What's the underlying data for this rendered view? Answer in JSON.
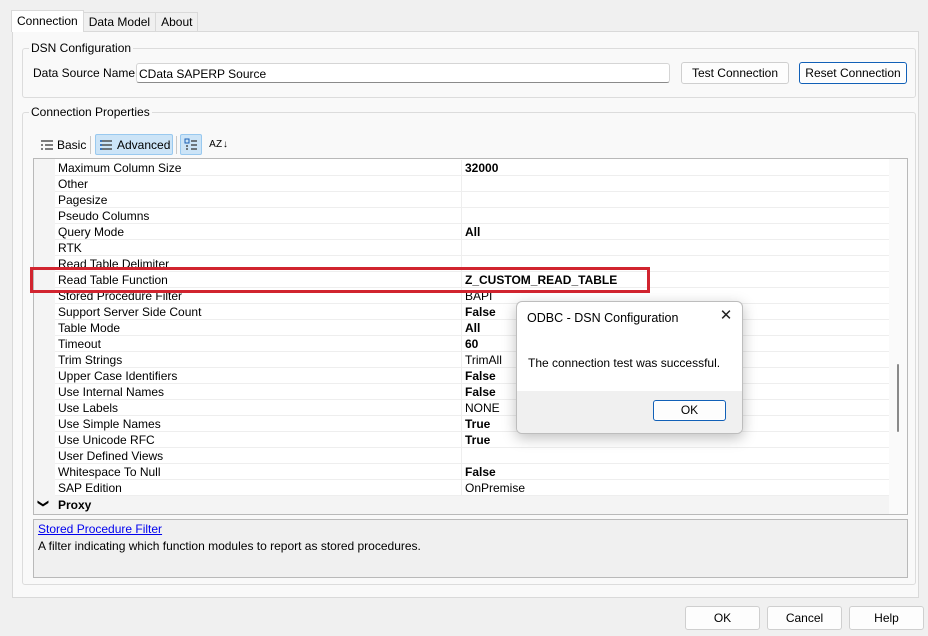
{
  "tabs": [
    {
      "label": "Connection",
      "active": true
    },
    {
      "label": "Data Model",
      "active": false
    },
    {
      "label": "About",
      "active": false
    }
  ],
  "dsn": {
    "group_title": "DSN Configuration",
    "name_label": "Data Source Name:",
    "name_value": "CData SAPERP Source",
    "test_button": "Test Connection",
    "reset_button": "Reset Connection"
  },
  "props": {
    "group_title": "Connection Properties",
    "toolbar": {
      "basic_label": "Basic",
      "advanced_label": "Advanced",
      "basic_icon": "list-icon",
      "advanced_icon": "list-icon",
      "categorized_icon": "categorized-icon",
      "sort_icon": "sort-az-icon",
      "sort_glyph": "A Z ↓"
    },
    "rows": [
      {
        "name": "Maximum Column Size",
        "value": "32000",
        "bold": true
      },
      {
        "name": "Other",
        "value": "",
        "bold": false
      },
      {
        "name": "Pagesize",
        "value": "",
        "bold": false
      },
      {
        "name": "Pseudo Columns",
        "value": "",
        "bold": false
      },
      {
        "name": "Query Mode",
        "value": "All",
        "bold": true
      },
      {
        "name": "RTK",
        "value": "",
        "bold": false
      },
      {
        "name": "Read Table Delimiter",
        "value": "",
        "bold": false
      },
      {
        "name": "Read Table Function",
        "value": "Z_CUSTOM_READ_TABLE",
        "bold": true
      },
      {
        "name": "Stored Procedure Filter",
        "value": "BAPI",
        "bold": false
      },
      {
        "name": "Support Server Side Count",
        "value": "False",
        "bold": true
      },
      {
        "name": "Table Mode",
        "value": "All",
        "bold": true
      },
      {
        "name": "Timeout",
        "value": "60",
        "bold": true
      },
      {
        "name": "Trim Strings",
        "value": "TrimAll",
        "bold": false
      },
      {
        "name": "Upper Case Identifiers",
        "value": "False",
        "bold": true
      },
      {
        "name": "Use Internal Names",
        "value": "False",
        "bold": true
      },
      {
        "name": "Use Labels",
        "value": "NONE",
        "bold": false
      },
      {
        "name": "Use Simple Names",
        "value": "True",
        "bold": true
      },
      {
        "name": "Use Unicode RFC",
        "value": "True",
        "bold": true
      },
      {
        "name": "User Defined Views",
        "value": "",
        "bold": false
      },
      {
        "name": "Whitespace To Null",
        "value": "False",
        "bold": true
      },
      {
        "name": "SAP Edition",
        "value": "OnPremise",
        "bold": false
      }
    ],
    "category": {
      "name": "Proxy",
      "icon": "chevron-down-icon",
      "glyph": "❯"
    },
    "selected_row": "Read Table Function",
    "highlight_color": "#d1242f"
  },
  "description": {
    "title": "Stored Procedure Filter",
    "text": "A filter indicating which function modules to report as stored procedures."
  },
  "dialog": {
    "title": "ODBC - DSN Configuration",
    "close_glyph": "✕",
    "message": "The connection test was successful.",
    "ok_button": "OK"
  },
  "footer": {
    "ok": "OK",
    "cancel": "Cancel",
    "help": "Help"
  }
}
